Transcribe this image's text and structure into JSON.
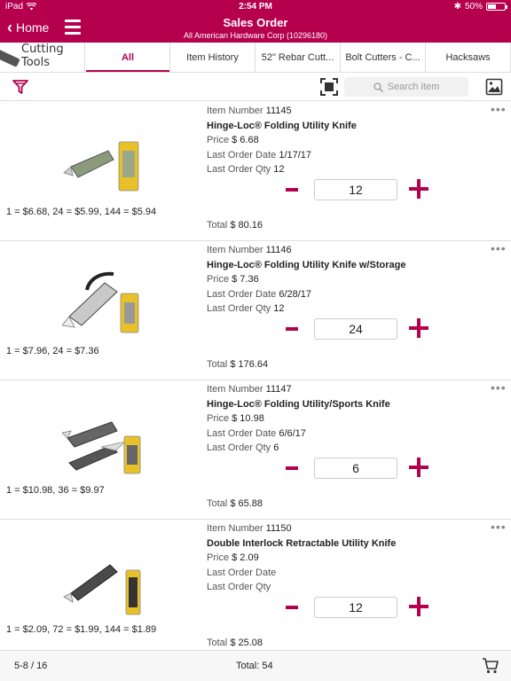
{
  "status_bar": {
    "carrier": "iPad",
    "time": "2:54 PM",
    "battery": "50%",
    "battery_level": 0.5
  },
  "nav": {
    "back_label": "Home",
    "title": "Sales Order",
    "subtitle": "All American Hardware Corp  (10296180)"
  },
  "category": {
    "label_line1": "Cutting",
    "label_line2": "Tools"
  },
  "tabs": [
    {
      "label": "All",
      "active": true
    },
    {
      "label": "Item History",
      "active": false
    },
    {
      "label": "52\" Rebar Cutt...",
      "active": false
    },
    {
      "label": "Bolt Cutters - C...",
      "active": false
    },
    {
      "label": "Hacksaws",
      "active": false
    }
  ],
  "toolbar": {
    "search_placeholder": "Search item"
  },
  "labels": {
    "item_number": "Item Number",
    "price": "Price",
    "last_order_date": "Last Order Date",
    "last_order_qty": "Last Order Qty",
    "total": "Total"
  },
  "items": [
    {
      "item_number": "11145",
      "name": "Hinge-Loc® Folding Utility Knife",
      "price": "$ 6.68",
      "last_order_date": "1/17/17",
      "last_order_qty": "12",
      "quantity": "12",
      "tier_pricing": "1 = $6.68, 24 = $5.99, 144 = $5.94",
      "total": "$ 80.16"
    },
    {
      "item_number": "11146",
      "name": "Hinge-Loc® Folding Utility Knife w/Storage",
      "price": "$ 7.36",
      "last_order_date": "6/28/17",
      "last_order_qty": "12",
      "quantity": "24",
      "tier_pricing": "1 = $7.96, 24 = $7.36",
      "total": "$ 176.64"
    },
    {
      "item_number": "11147",
      "name": "Hinge-Loc® Folding Utility/Sports Knife",
      "price": "$ 10.98",
      "last_order_date": "6/6/17",
      "last_order_qty": "6",
      "quantity": "6",
      "tier_pricing": "1 = $10.98, 36 = $9.97",
      "total": "$ 65.88"
    },
    {
      "item_number": "11150",
      "name": "Double Interlock Retractable Utility Knife",
      "price": "$ 2.09",
      "last_order_date": "",
      "last_order_qty": "",
      "quantity": "12",
      "tier_pricing": "1 = $2.09, 72 = $1.99, 144 = $1.89",
      "total": "$ 25.08"
    }
  ],
  "footer": {
    "pager": "5-8 / 16",
    "grand_total": "Total: 54"
  },
  "colors": {
    "accent": "#b5004e",
    "divider": "#dddddd"
  }
}
